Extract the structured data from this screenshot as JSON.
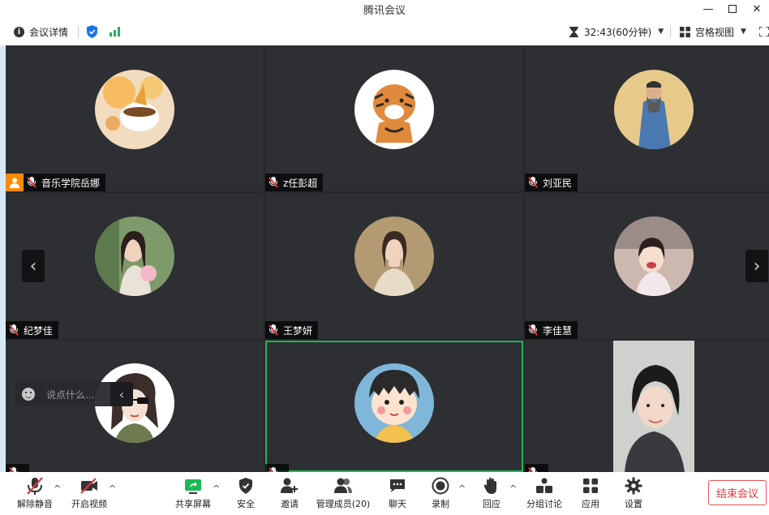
{
  "window": {
    "title": "腾讯会议"
  },
  "infobar": {
    "details_label": "会议详情",
    "timer": "32:43(60分钟)",
    "view_label": "宫格视图"
  },
  "participants": [
    {
      "name": "音乐学院岳娜",
      "host": true
    },
    {
      "name": "z任彭超"
    },
    {
      "name": "刘亚民"
    },
    {
      "name": "纪梦佳"
    },
    {
      "name": "王梦妍"
    },
    {
      "name": "李佳慧"
    },
    {
      "name": ""
    },
    {
      "name": "",
      "active": true
    },
    {
      "name": "",
      "video_on": true
    }
  ],
  "chat": {
    "placeholder": "说点什么..."
  },
  "toolbar": {
    "unmute": "解除静音",
    "start_video": "开启视频",
    "share_screen": "共享屏幕",
    "security": "安全",
    "invite": "邀请",
    "manage_members": "管理成员(20)",
    "chat": "聊天",
    "record": "录制",
    "reactions": "回应",
    "breakout": "分组讨论",
    "apps": "应用",
    "settings": "设置",
    "end_meeting": "结束会议"
  },
  "colors": {
    "tile_bg": "#2d2f33",
    "active_border": "#19b955",
    "end_button": "#e0383e",
    "host_badge": "#ff8a00"
  }
}
